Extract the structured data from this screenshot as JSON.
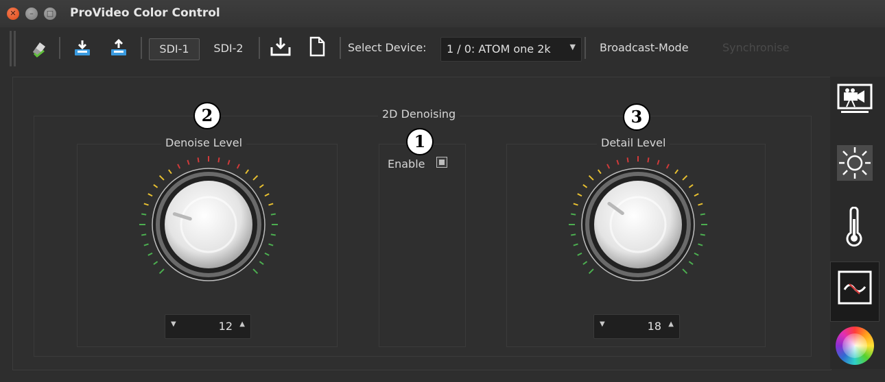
{
  "window": {
    "title": "ProVideo Color Control",
    "close_icon": "close-icon",
    "minimize_icon": "minimize-icon",
    "maximize_icon": "maximize-icon"
  },
  "toolbar": {
    "icons": [
      "eraser-icon",
      "download-tray-icon",
      "upload-tray-icon",
      "save-download-icon",
      "new-document-icon"
    ],
    "sdi1_label": "SDI-1",
    "sdi2_label": "SDI-2",
    "active_channel": "SDI-1",
    "select_device_label": "Select Device:",
    "device_value": "1 / 0: ATOM one 2k",
    "broadcast_label": "Broadcast-Mode",
    "synchronise_label": "Synchronise"
  },
  "main": {
    "group_title": "2D Denoising",
    "denoise": {
      "title": "Denoise Level",
      "value": "12",
      "badge": "2"
    },
    "enable": {
      "label": "Enable",
      "checked": false,
      "badge": "1"
    },
    "detail": {
      "title": "Detail Level",
      "value": "18",
      "badge": "3"
    }
  },
  "sidebar": {
    "items": [
      {
        "icon": "camera-monitor-icon",
        "selected": false
      },
      {
        "icon": "brightness-sun-icon",
        "selected": false
      },
      {
        "icon": "thermometer-icon",
        "selected": false
      },
      {
        "icon": "waveform-filter-icon",
        "selected": true
      },
      {
        "icon": "color-wheel-icon",
        "selected": false
      }
    ]
  },
  "colors": {
    "background": "#2e2e2e",
    "close_button": "#e95420",
    "tick_green": "#4caf50",
    "tick_yellow": "#e8c030",
    "tick_red": "#d23a3a",
    "toolbar_icon_blue": "#3a9be0"
  }
}
